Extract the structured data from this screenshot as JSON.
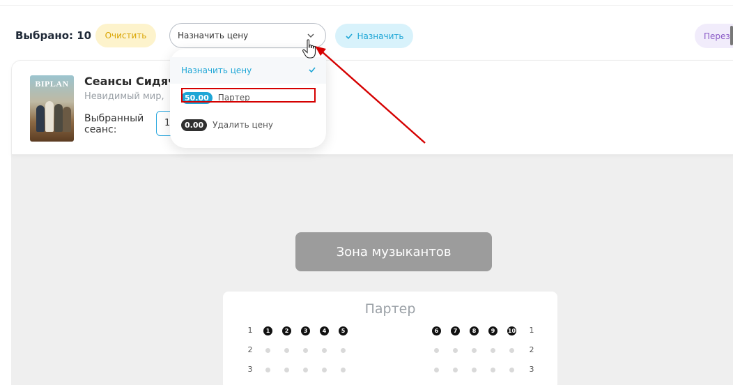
{
  "toolbar": {
    "selected_label": "Выбрано: 10",
    "clear_label": "Очистить",
    "price_select_value": "Назначить цену",
    "assign_label": "Назначить",
    "reassign_label": "Переза"
  },
  "show": {
    "poster_title": "BIPLAN",
    "title": "Сеансы Сидяч",
    "subtitle": "Невидимый мир, ",
    "session_label": "Выбранный сеанс:",
    "session_value": "1"
  },
  "dropdown": {
    "items": [
      {
        "label": "Назначить цену",
        "selected": true
      },
      {
        "badge": "50.00",
        "label": "Партер",
        "badge_color": "#1ea6d6"
      },
      {
        "badge": "0.00",
        "label": "Удалить цену",
        "badge_color": "#2f2f2f"
      }
    ]
  },
  "stage": {
    "label": "Зона музыкантов"
  },
  "seating": {
    "zone": "Партер",
    "rows": [
      {
        "row": "1",
        "left_seats": [
          "1",
          "2",
          "3",
          "4",
          "5"
        ],
        "right_seats": [
          "6",
          "7",
          "8",
          "9",
          "10"
        ],
        "selected": true
      },
      {
        "row": "2",
        "selected": false
      },
      {
        "row": "3",
        "selected": false
      }
    ]
  },
  "colors": {
    "accent": "#1ea6d6",
    "clear_bg": "#fdf3cc",
    "clear_text": "#d9a400",
    "annotation": "#d50000"
  },
  "icons": [
    "chevron-down-icon",
    "check-icon",
    "hand-cursor-icon",
    "arrow-annotation"
  ]
}
